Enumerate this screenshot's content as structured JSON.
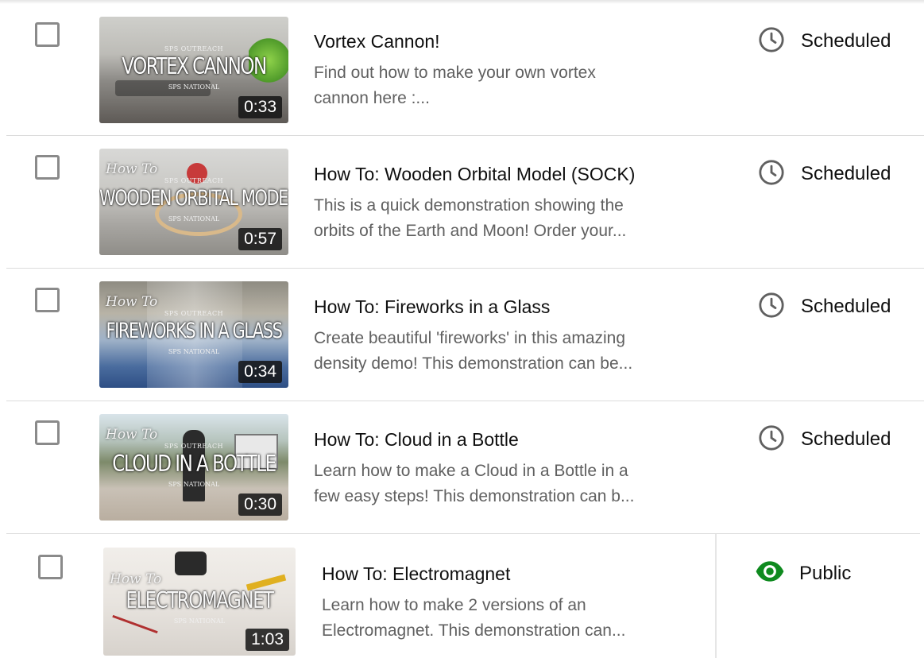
{
  "videos": [
    {
      "title": "Vortex Cannon!",
      "description_line1": "Find out how to make your own vortex",
      "description_line2": "cannon here :...",
      "duration": "0:33",
      "status": "Scheduled",
      "status_icon": "clock-icon",
      "thumbnail": {
        "howto": "",
        "top": "SPS OUTREACH",
        "main": "VORTEX CANNON",
        "bottom": "SPS NATIONAL"
      }
    },
    {
      "title": "How To: Wooden Orbital Model (SOCK)",
      "description_line1": "This is a quick demonstration showing the",
      "description_line2": "orbits of the Earth and Moon! Order your...",
      "duration": "0:57",
      "status": "Scheduled",
      "status_icon": "clock-icon",
      "thumbnail": {
        "howto": "How To",
        "top": "SPS OUTREACH",
        "main": "WOODEN ORBITAL MODEL",
        "bottom": "SPS NATIONAL"
      }
    },
    {
      "title": "How To: Fireworks in a Glass",
      "description_line1": "Create beautiful 'fireworks' in this amazing",
      "description_line2": "density demo! This demonstration can be...",
      "duration": "0:34",
      "status": "Scheduled",
      "status_icon": "clock-icon",
      "thumbnail": {
        "howto": "How To",
        "top": "SPS OUTREACH",
        "main": "FIREWORKS IN A GLASS",
        "bottom": "SPS NATIONAL"
      }
    },
    {
      "title": "How To: Cloud in a Bottle",
      "description_line1": "Learn how to make a Cloud in a Bottle in a",
      "description_line2": "few easy steps! This demonstration can b...",
      "duration": "0:30",
      "status": "Scheduled",
      "status_icon": "clock-icon",
      "thumbnail": {
        "howto": "How To",
        "top": "SPS OUTREACH",
        "main": "CLOUD IN A BOTTLE",
        "bottom": "SPS NATIONAL"
      }
    },
    {
      "title": "How To: Electromagnet",
      "description_line1": "Learn how to make 2 versions of an",
      "description_line2": "Electromagnet. This demonstration can...",
      "duration": "1:03",
      "status": "Public",
      "status_icon": "eye-icon",
      "thumbnail": {
        "howto": "How To",
        "top": "",
        "main": "ELECTROMAGNET",
        "bottom": "SPS NATIONAL"
      }
    }
  ],
  "colors": {
    "public_green": "#0f8a1f",
    "clock_gray": "#606060",
    "description_gray": "#606060",
    "divider": "#dcdcdc"
  }
}
